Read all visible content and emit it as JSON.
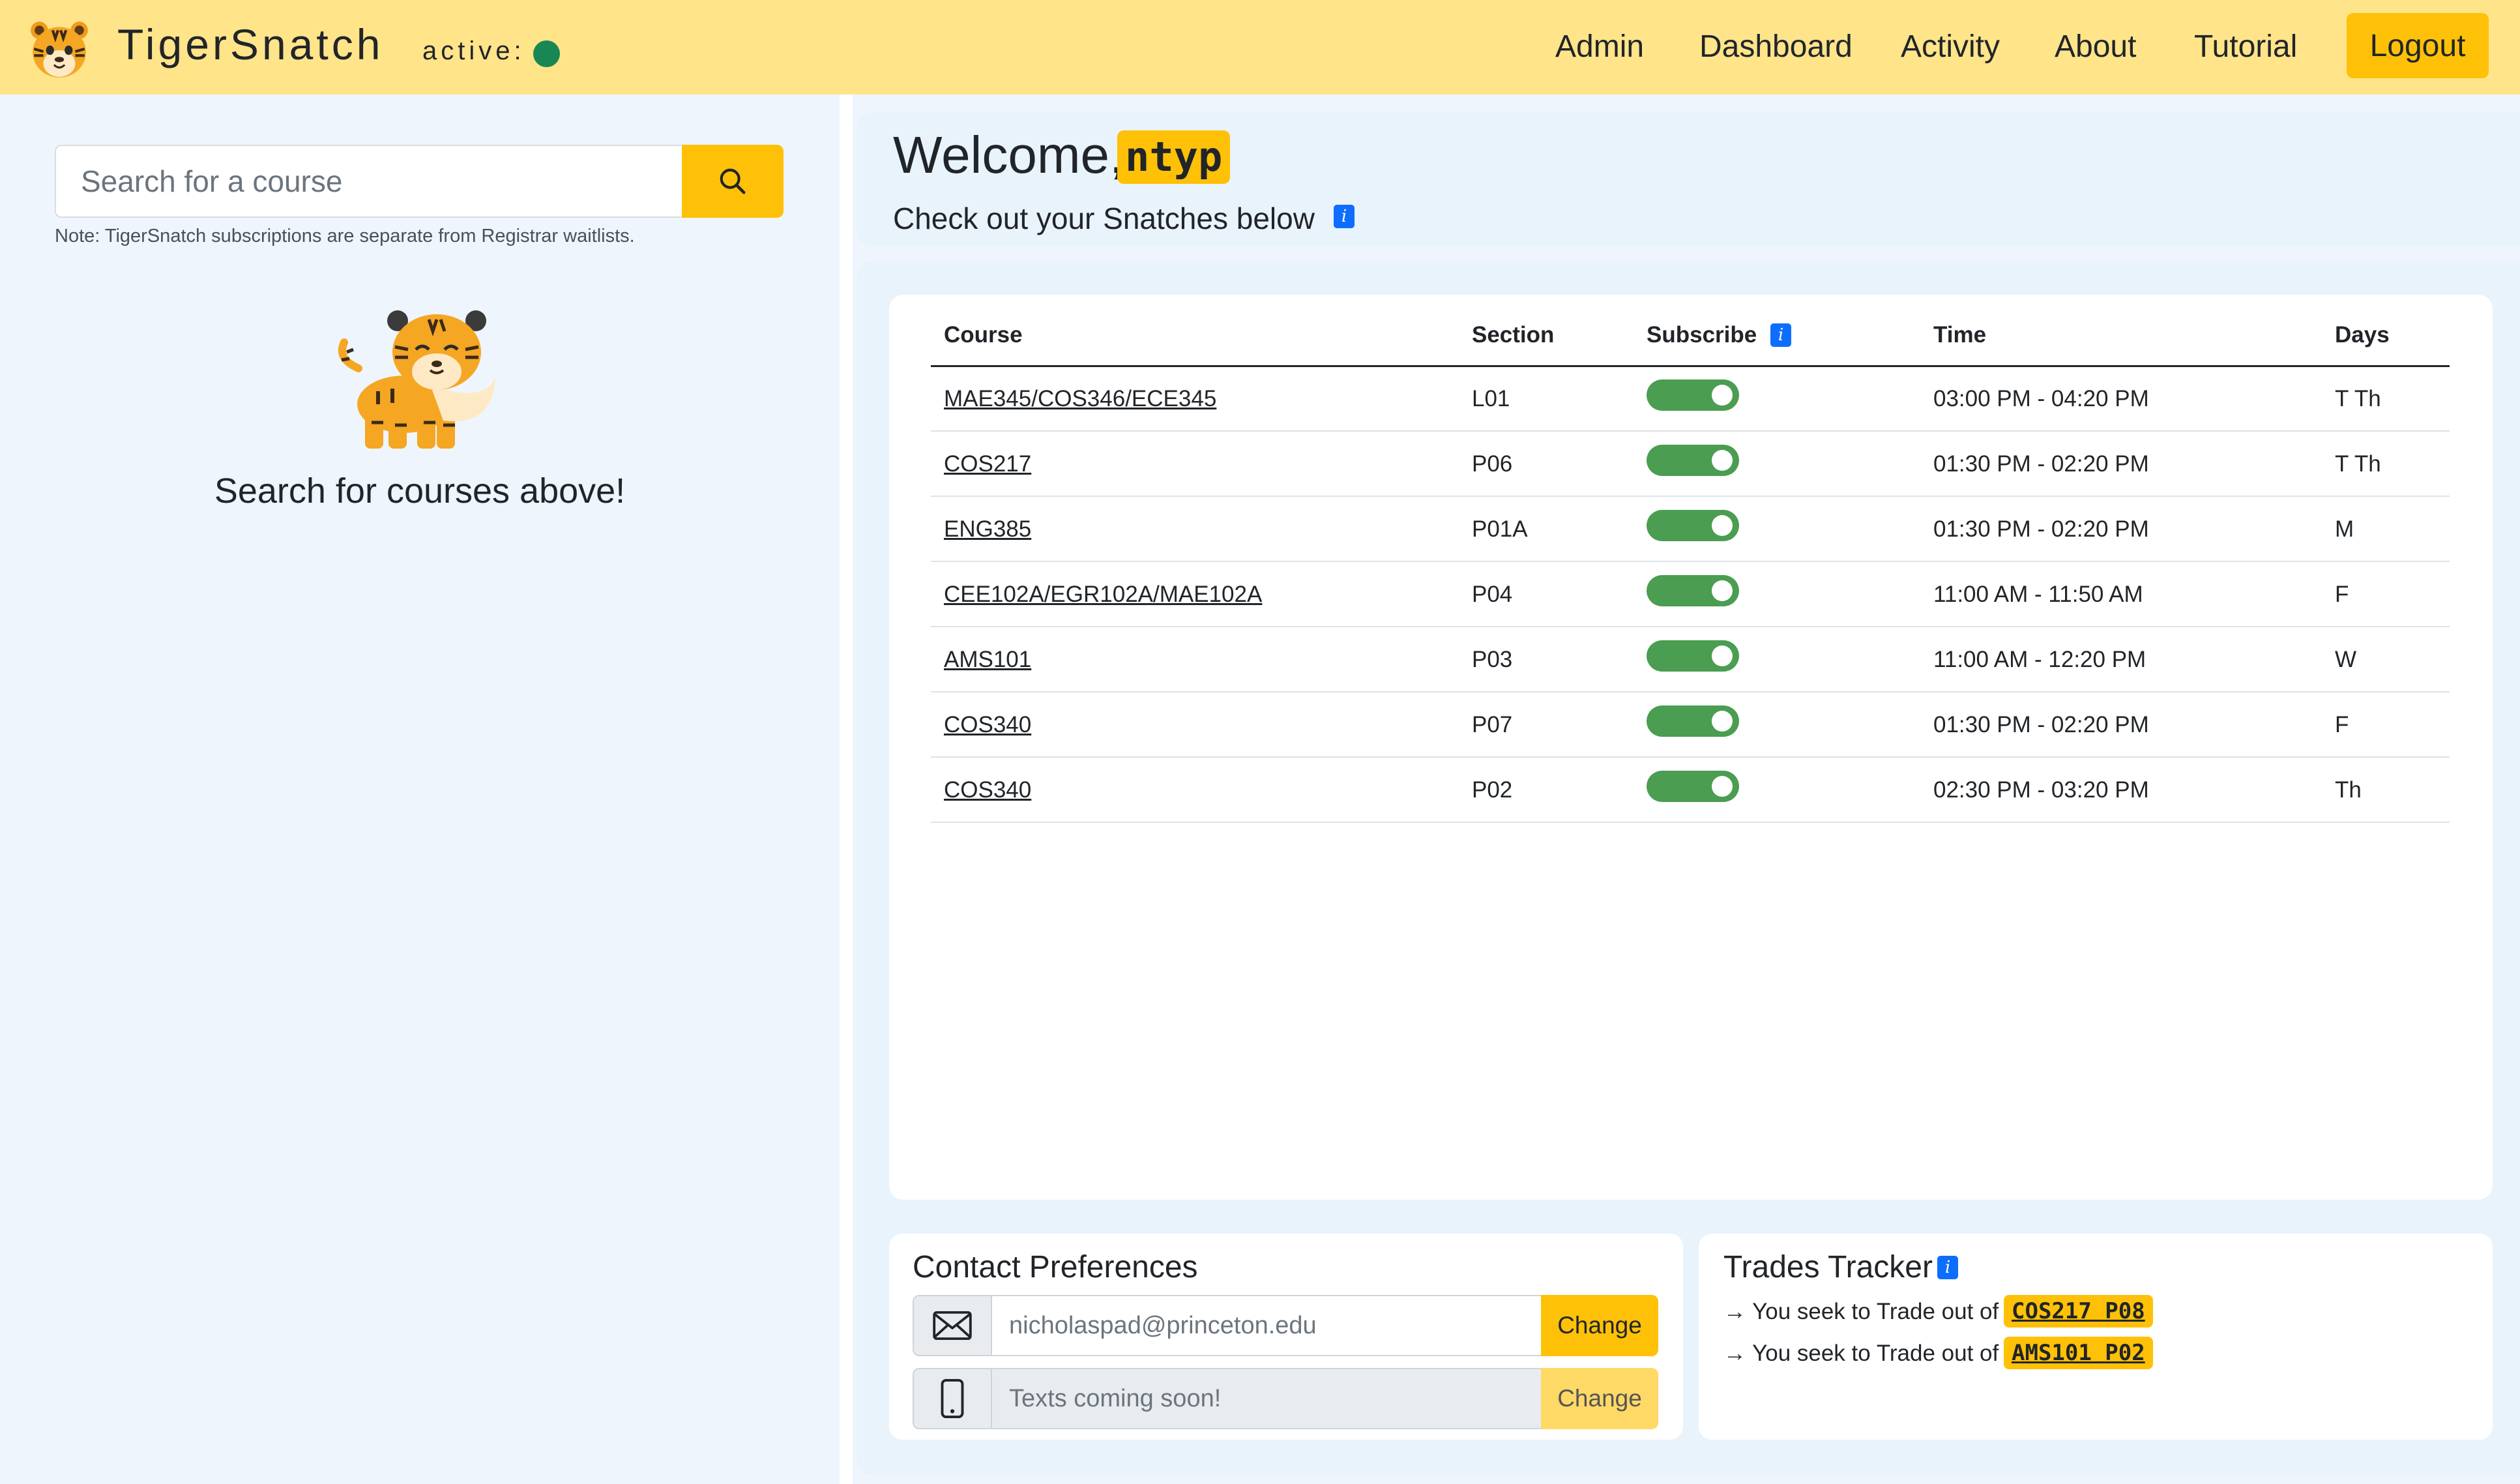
{
  "navbar": {
    "brand": "TigerSnatch",
    "active_label": "active:",
    "links": [
      "Admin",
      "Dashboard",
      "Activity",
      "About",
      "Tutorial"
    ],
    "logout": "Logout"
  },
  "sidebar": {
    "search_placeholder": "Search for a course",
    "note": "Note: TigerSnatch subscriptions are separate from Registrar waitlists.",
    "prompt": "Search for courses above!"
  },
  "welcome": {
    "greeting": "Welcome,",
    "netid": "ntyp",
    "subtitle": "Check out your Snatches below"
  },
  "table": {
    "headers": [
      "Course",
      "Section",
      "Subscribe",
      "Time",
      "Days"
    ],
    "rows": [
      {
        "course": "MAE345/COS346/ECE345",
        "section": "L01",
        "subscribed": true,
        "time": "03:00 PM - 04:20 PM",
        "days": "T Th"
      },
      {
        "course": "COS217",
        "section": "P06",
        "subscribed": true,
        "time": "01:30 PM - 02:20 PM",
        "days": "T Th"
      },
      {
        "course": "ENG385",
        "section": "P01A",
        "subscribed": true,
        "time": "01:30 PM - 02:20 PM",
        "days": "M"
      },
      {
        "course": "CEE102A/EGR102A/MAE102A",
        "section": "P04",
        "subscribed": true,
        "time": "11:00 AM - 11:50 AM",
        "days": "F"
      },
      {
        "course": "AMS101",
        "section": "P03",
        "subscribed": true,
        "time": "11:00 AM - 12:20 PM",
        "days": "W"
      },
      {
        "course": "COS340",
        "section": "P07",
        "subscribed": true,
        "time": "01:30 PM - 02:20 PM",
        "days": "F"
      },
      {
        "course": "COS340",
        "section": "P02",
        "subscribed": true,
        "time": "02:30 PM - 03:20 PM",
        "days": "Th"
      }
    ]
  },
  "contact": {
    "title": "Contact Preferences",
    "email_value": "nicholaspad@princeton.edu",
    "phone_placeholder": "Texts coming soon!",
    "change_label": "Change"
  },
  "trades": {
    "title": "Trades Tracker",
    "items": [
      {
        "text": "→ You seek to Trade out of",
        "badge": "COS217 P08"
      },
      {
        "text": "→ You seek to Trade out of",
        "badge": "AMS101 P02"
      }
    ]
  },
  "colors": {
    "navbar_bg": "#ffe48a",
    "accent": "#ffc107",
    "active_dot": "#198754",
    "toggle_on": "#4a9d51",
    "info_blue": "#0d6efd",
    "page_bg": "#eef5fc"
  },
  "icons": [
    "tiger-logo-icon",
    "search-icon",
    "info-icon",
    "envelope-icon",
    "phone-icon",
    "tiger-mascot-icon"
  ]
}
